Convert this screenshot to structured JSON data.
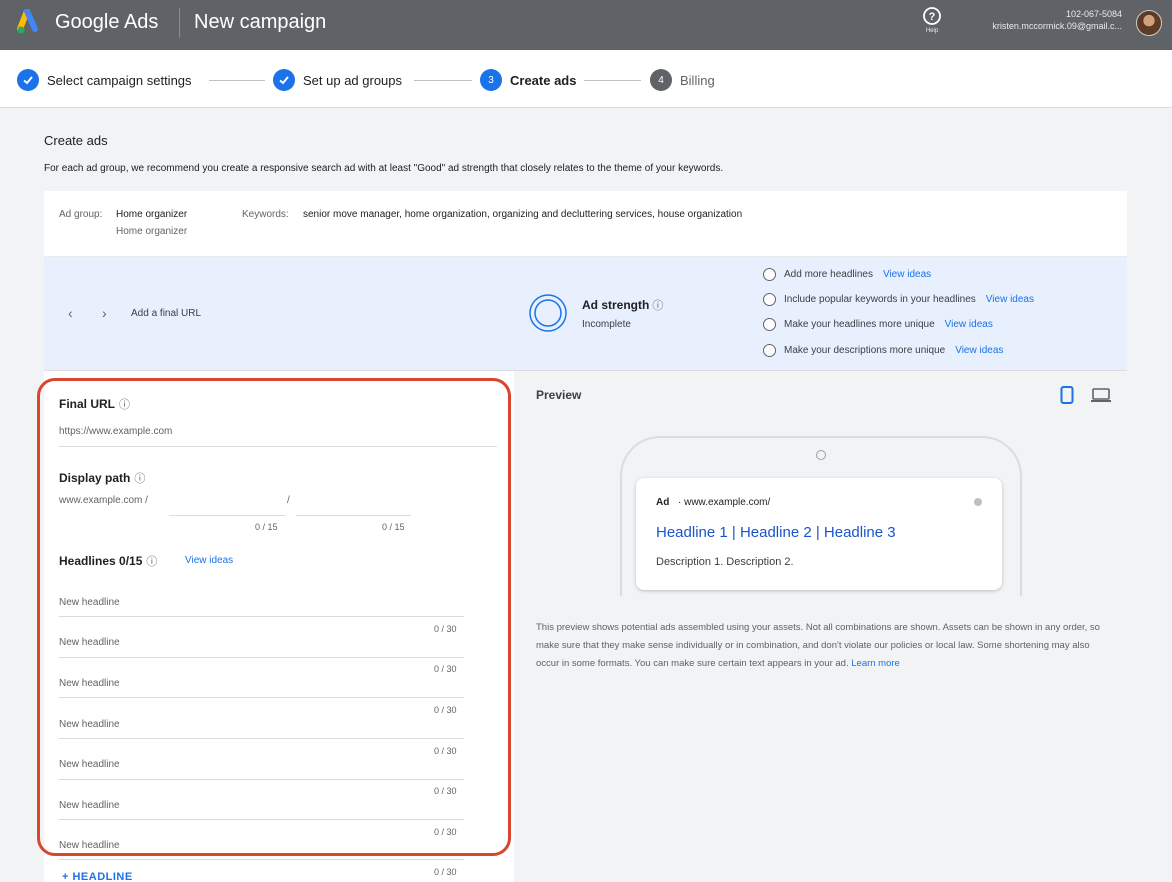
{
  "header": {
    "brand": "Google Ads",
    "campaign_title": "New campaign",
    "help_label": "Help",
    "account_id": "102-067-5084",
    "account_email": "kristen.mccormick.09@gmail.c..."
  },
  "stepper": {
    "steps": [
      {
        "label": "Select campaign settings",
        "state": "done",
        "marker": ""
      },
      {
        "label": "Set up ad groups",
        "state": "done",
        "marker": ""
      },
      {
        "label": "Create ads",
        "state": "current",
        "marker": "3"
      },
      {
        "label": "Billing",
        "state": "todo",
        "marker": "4"
      }
    ]
  },
  "page": {
    "heading": "Create ads",
    "subheading": "For each ad group, we recommend you create a responsive search ad with at least \"Good\" ad strength that closely relates to the theme of your keywords."
  },
  "ad_group": {
    "label": "Ad group:",
    "name": "Home organizer",
    "name_secondary": "Home organizer",
    "keywords_label": "Keywords:",
    "keywords": "senior move manager, home organization, organizing and decluttering services, house organization"
  },
  "strength": {
    "prev": "‹",
    "next": "›",
    "final_url_hint": "Add a final URL",
    "title": "Ad strength",
    "help": "?",
    "status": "Incomplete",
    "suggestions": [
      {
        "text": "Add more headlines",
        "link": "View ideas"
      },
      {
        "text": "Include popular keywords in your headlines",
        "link": "View ideas"
      },
      {
        "text": "Make your headlines more unique",
        "link": "View ideas"
      },
      {
        "text": "Make your descriptions more unique",
        "link": "View ideas"
      }
    ]
  },
  "form": {
    "final_url": {
      "label": "Final URL",
      "help": "?",
      "placeholder": "https://www.example.com"
    },
    "display_path": {
      "label": "Display path",
      "help": "?",
      "prefix": "www.example.com /",
      "separator": "/",
      "path1_counter": "0 / 15",
      "path2_counter": "0 / 15"
    },
    "headlines": {
      "label": "Headlines 0/15",
      "help": "?",
      "view_ideas": "View ideas",
      "items": [
        {
          "placeholder": "New headline",
          "counter": "0 / 30"
        },
        {
          "placeholder": "New headline",
          "counter": "0 / 30"
        },
        {
          "placeholder": "New headline",
          "counter": "0 / 30"
        },
        {
          "placeholder": "New headline",
          "counter": "0 / 30"
        },
        {
          "placeholder": "New headline",
          "counter": "0 / 30"
        },
        {
          "placeholder": "New headline",
          "counter": "0 / 30"
        },
        {
          "placeholder": "New headline",
          "counter": "0 / 30"
        }
      ],
      "add_button": "+ HEADLINE"
    }
  },
  "preview": {
    "title": "Preview",
    "ad_badge": "Ad",
    "ad_url": "· www.example.com/",
    "headline": "Headline 1 | Headline 2 | Headline 3",
    "description": "Description 1. Description 2.",
    "note": "This preview shows potential ads assembled using your assets. Not all combinations are shown. Assets can be shown in any order, so make sure that they make sense individually or in combination, and don't violate our policies or local law. Some shortening may also occur in some formats. You can make sure certain text appears in your ad.",
    "learn_more": "Learn more"
  },
  "colors": {
    "accent": "#1a73e8",
    "header_bg": "#5f6368",
    "highlight": "#d9462f",
    "strength_band": "#e8f0fe"
  }
}
